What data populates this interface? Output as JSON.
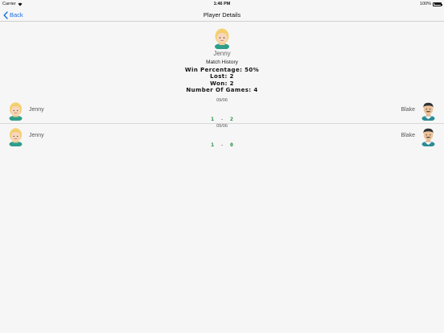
{
  "status_bar": {
    "carrier": "Carrier",
    "time": "1:46 PM",
    "battery": "100%"
  },
  "nav": {
    "back_label": "Back",
    "title": "Player Details"
  },
  "player": {
    "name": "Jenny",
    "avatar_icon": "blonde-girl-avatar-icon"
  },
  "history": {
    "title": "Match History",
    "win_percentage": "Win Percentage: 50%",
    "lost": "Lost: 2",
    "won": "Won: 2",
    "games": "Number Of Games: 4"
  },
  "matches": [
    {
      "date": "09/06",
      "left_player": "Jenny",
      "right_player": "Blake",
      "left_score": "1",
      "separator": "-",
      "right_score": "2"
    },
    {
      "date": "09/06",
      "left_player": "Jenny",
      "right_player": "Blake",
      "left_score": "1",
      "separator": "-",
      "right_score": "0"
    }
  ],
  "colors": {
    "accent": "#1a6fe0",
    "score": "#1e8a3a",
    "background": "#f6f6f6"
  }
}
